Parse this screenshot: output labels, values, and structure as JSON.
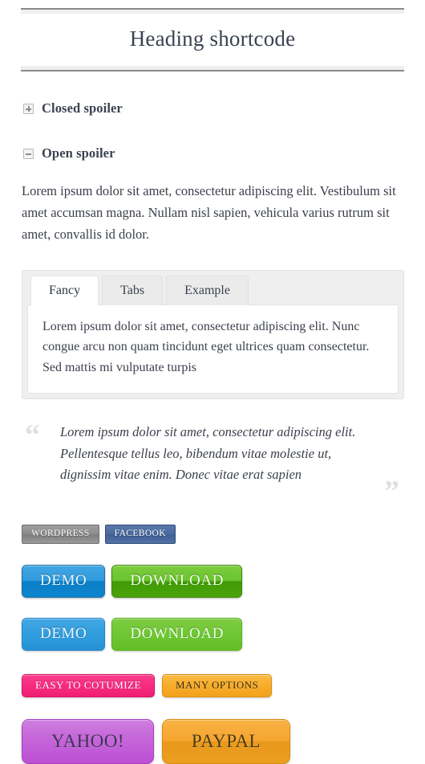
{
  "heading": {
    "title": "Heading shortcode"
  },
  "spoilers": [
    {
      "icon": "plus-square-icon",
      "label": "Closed spoiler",
      "state": "closed"
    },
    {
      "icon": "minus-square-icon",
      "label": "Open spoiler",
      "state": "open"
    }
  ],
  "body_paragraph": "Lorem ipsum dolor sit amet, consectetur adipiscing elit. Vestibulum sit amet accumsan magna. Nullam nisl sapien, vehicula varius rutrum sit amet, convallis id dolor.",
  "tabs": {
    "items": [
      {
        "label": "Fancy",
        "active": true
      },
      {
        "label": "Tabs",
        "active": false
      },
      {
        "label": "Example",
        "active": false
      }
    ],
    "panel_text": "Lorem ipsum dolor sit amet, consectetur adipiscing elit. Nunc congue arcu non quam tincidunt eget ultrices quam consectetur. Sed mattis mi vulputate turpis"
  },
  "blockquote": {
    "open_mark": "“",
    "close_mark": "”",
    "text": "Lorem ipsum dolor sit amet, consectetur adipiscing elit. Pellentesque tellus leo, bibendum vitae molestie ut, dignissim vitae enim. Donec vitae erat sapien"
  },
  "button_rows": [
    {
      "name": "small-buttons-row",
      "buttons": [
        {
          "label": "WORDPRESS",
          "color": "#8d8d8d"
        },
        {
          "label": "FACEBOOK",
          "color": "#4a6a9f"
        }
      ]
    },
    {
      "name": "gradient-3d-buttons-row",
      "buttons": [
        {
          "label": "DEMO",
          "color": "#2e9ade"
        },
        {
          "label": "DOWNLOAD",
          "color": "#6ac42f"
        }
      ]
    },
    {
      "name": "flat-buttons-row",
      "buttons": [
        {
          "label": "DEMO",
          "color": "#2f9ddd"
        },
        {
          "label": "DOWNLOAD",
          "color": "#6dc633"
        }
      ]
    },
    {
      "name": "pill-buttons-row",
      "buttons": [
        {
          "label": "EASY TO COTUMIZE",
          "color": "#f72a7f"
        },
        {
          "label": "MANY OPTIONS",
          "color": "#f7ab28"
        }
      ]
    },
    {
      "name": "large-buttons-row",
      "buttons": [
        {
          "label": "YAHOO!",
          "color": "#c667da"
        },
        {
          "label": "PAYPAL",
          "color": "#f5a52f"
        }
      ]
    }
  ]
}
